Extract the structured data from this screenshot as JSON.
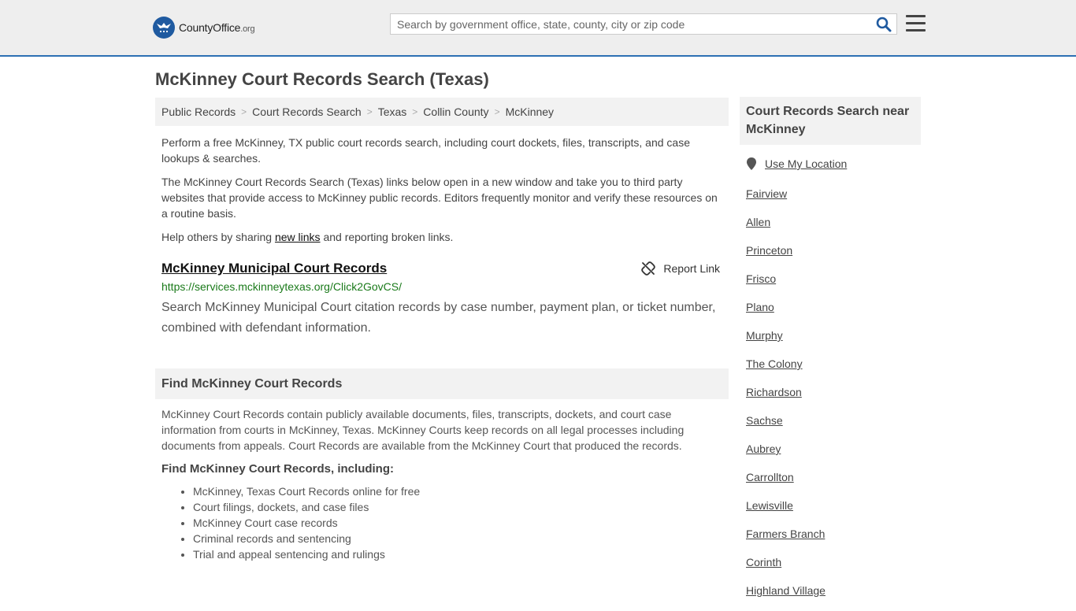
{
  "header": {
    "logo_main": "CountyOffice",
    "logo_suffix": ".org",
    "search_placeholder": "Search by government office, state, county, city or zip code"
  },
  "page": {
    "title": "McKinney Court Records Search (Texas)"
  },
  "breadcrumb": {
    "items": [
      "Public Records",
      "Court Records Search",
      "Texas",
      "Collin County"
    ],
    "current": "McKinney",
    "separator": ">"
  },
  "intro": {
    "p1": "Perform a free McKinney, TX public court records search, including court dockets, files, transcripts, and case lookups & searches.",
    "p2": "The McKinney Court Records Search (Texas) links below open in a new window and take you to third party websites that provide access to McKinney public records. Editors frequently monitor and verify these resources on a routine basis.",
    "p3_before": "Help others by sharing ",
    "p3_link": "new links",
    "p3_after": " and reporting broken links."
  },
  "record": {
    "title": "McKinney Municipal Court Records",
    "url": "https://services.mckinneytexas.org/Click2GovCS/",
    "description": "Search McKinney Municipal Court citation records by case number, payment plan, or ticket number, combined with defendant information.",
    "report_label": "Report Link"
  },
  "section": {
    "heading": "Find McKinney Court Records",
    "body": "McKinney Court Records contain publicly available documents, files, transcripts, dockets, and court case information from courts in McKinney, Texas. McKinney Courts keep records on all legal processes including documents from appeals. Court Records are available from the McKinney Court that produced the records.",
    "subheading": "Find McKinney Court Records, including:",
    "list": [
      "McKinney, Texas Court Records online for free",
      "Court filings, dockets, and case files",
      "McKinney Court case records",
      "Criminal records and sentencing",
      "Trial and appeal sentencing and rulings"
    ]
  },
  "sidebar": {
    "heading": "Court Records Search near McKinney",
    "use_location": "Use My Location",
    "cities": [
      "Fairview",
      "Allen",
      "Princeton",
      "Frisco",
      "Plano",
      "Murphy",
      "The Colony",
      "Richardson",
      "Sachse",
      "Aubrey",
      "Carrollton",
      "Lewisville",
      "Farmers Branch",
      "Corinth",
      "Highland Village"
    ]
  },
  "colors": {
    "header_bg": "#eeeeee",
    "header_border": "#2d70b3",
    "logo_blue": "#1f5aa0",
    "url_green": "#1a7a1a",
    "panel_bg": "#f2f2f2"
  },
  "icons": {
    "logo": "eagle-seal-icon",
    "search": "magnifier-icon",
    "menu": "hamburger-icon",
    "report": "broken-link-icon",
    "location": "map-pin-icon"
  }
}
